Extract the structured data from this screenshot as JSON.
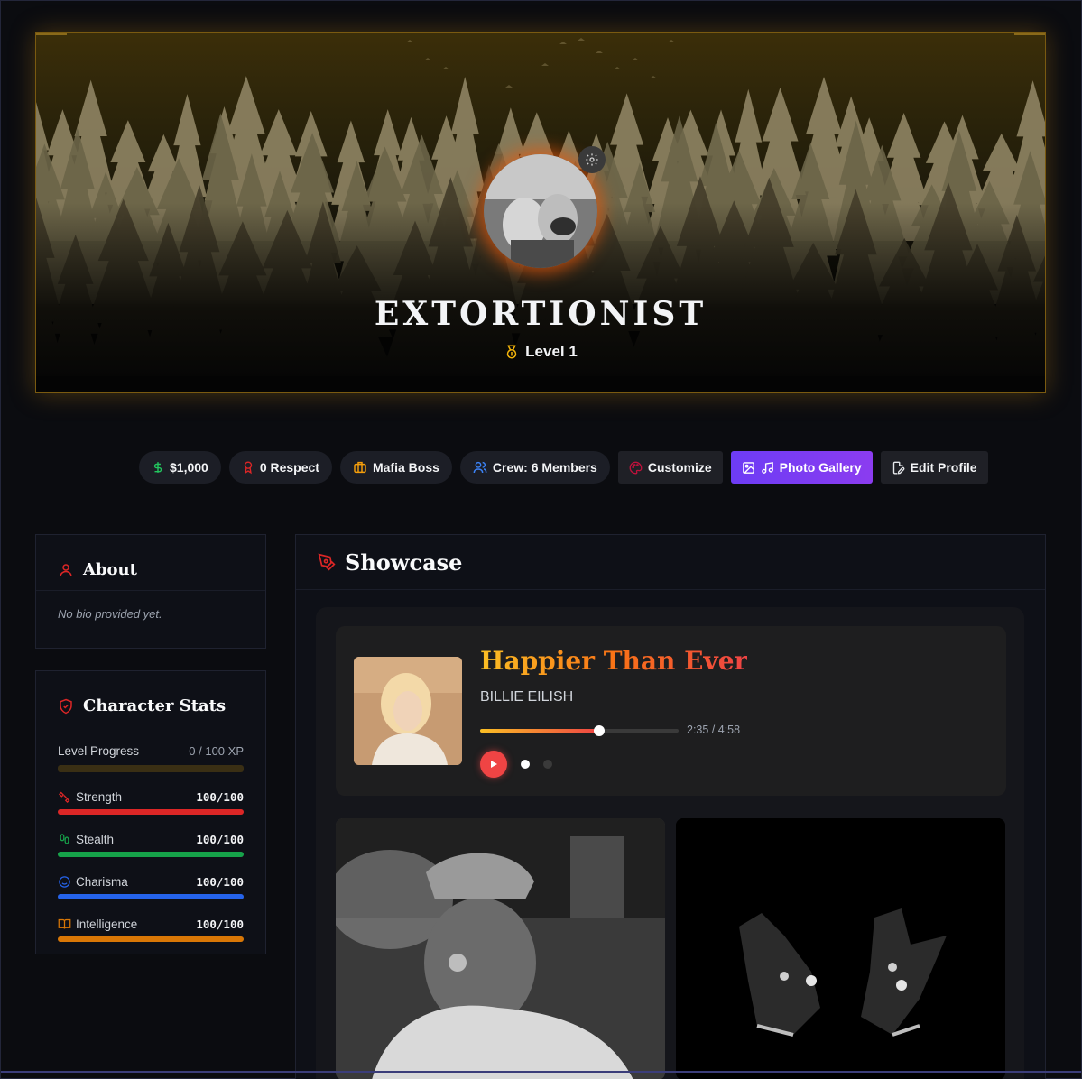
{
  "profile": {
    "username": "EXTORTIONIST",
    "level_label": "Level 1"
  },
  "pills": {
    "money": "$1,000",
    "respect": "0 Respect",
    "rank": "Mafia Boss",
    "crew": "Crew: 6 Members"
  },
  "actions": {
    "customize": "Customize",
    "gallery": "Photo Gallery",
    "edit": "Edit Profile"
  },
  "about": {
    "title": "About",
    "bio": "No bio provided yet."
  },
  "stats": {
    "title": "Character Stats",
    "level_progress_label": "Level Progress",
    "level_progress_value": "0 / 100 XP",
    "level_progress_fraction": 0,
    "items": [
      {
        "name": "Strength",
        "value": "100/100",
        "fraction": 1.0,
        "color": "#dc2626"
      },
      {
        "name": "Stealth",
        "value": "100/100",
        "fraction": 1.0,
        "color": "#16a34a"
      },
      {
        "name": "Charisma",
        "value": "100/100",
        "fraction": 1.0,
        "color": "#2563eb"
      },
      {
        "name": "Intelligence",
        "value": "100/100",
        "fraction": 1.0,
        "color": "#d97706"
      }
    ]
  },
  "showcase": {
    "title": "Showcase",
    "player": {
      "song": "Happier Than Ever",
      "artist": "BILLIE EILISH",
      "time": "2:35 / 4:58",
      "progress_fraction": 0.6
    }
  },
  "colors": {
    "accent_gold": "#c98714",
    "accent_purple": "#7c3aed",
    "play_red": "#ef4444"
  },
  "icons": {
    "money": "dollar-icon",
    "respect": "award-icon",
    "rank": "briefcase-icon",
    "crew": "users-icon",
    "customize": "palette-icon",
    "gallery": "image-icon",
    "edit": "file-edit-icon"
  }
}
